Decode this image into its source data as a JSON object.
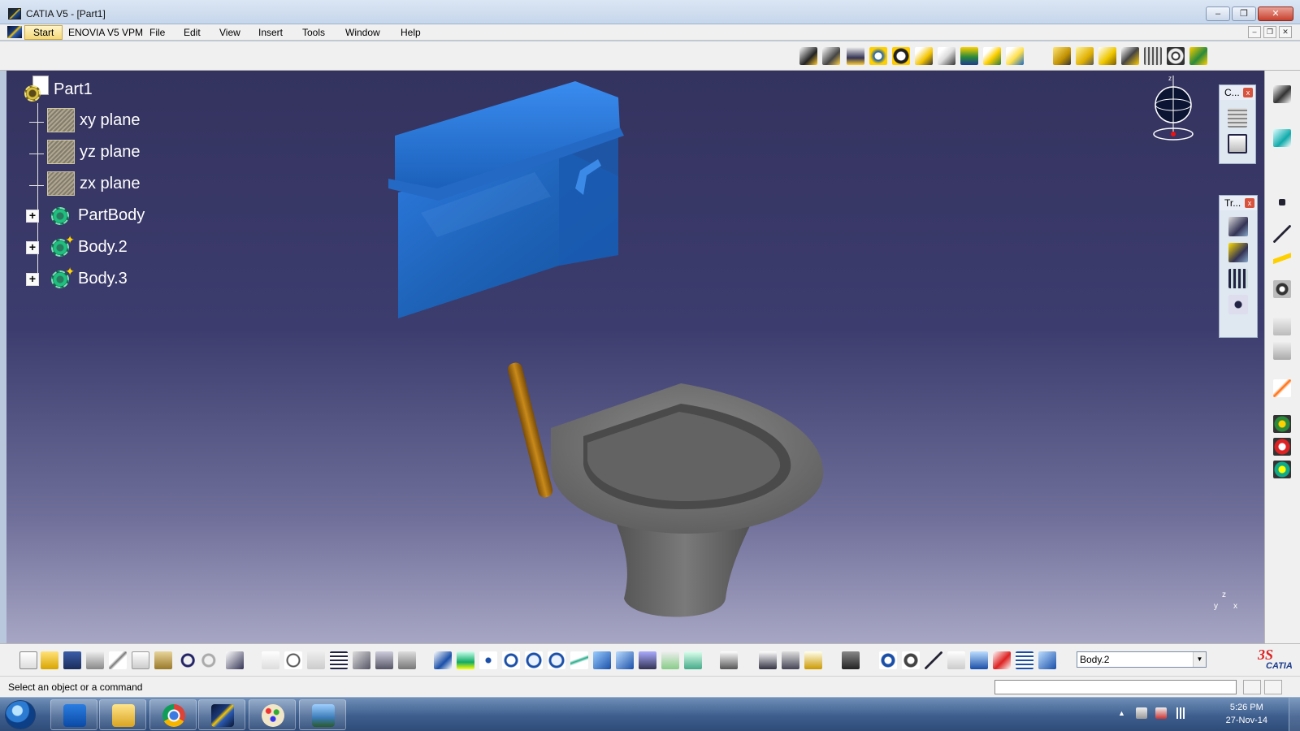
{
  "window": {
    "title": "CATIA V5 - [Part1]",
    "min_glyph": "–",
    "max_glyph": "❐",
    "close_glyph": "✕"
  },
  "menu": {
    "items": [
      "Start",
      "ENOVIA V5 VPM",
      "File",
      "Edit",
      "View",
      "Insert",
      "Tools",
      "Window",
      "Help"
    ]
  },
  "tree": {
    "root": "Part1",
    "planes": [
      "xy plane",
      "yz plane",
      "zx plane"
    ],
    "bodies": [
      "PartBody",
      "Body.2",
      "Body.3"
    ],
    "expander_glyph": "+"
  },
  "float_toolbars": {
    "compass_tb_title": "C...",
    "transform_tb_title": "Tr...",
    "close_glyph": "x"
  },
  "axis": {
    "z_label": "z",
    "x_label": "x",
    "y_label": "y"
  },
  "bottom": {
    "current_body": "Body.2",
    "combo_arrow": "▼"
  },
  "brand": {
    "ds": "3S",
    "name": "CATIA"
  },
  "status": {
    "message": "Select an object or a command"
  },
  "taskbar": {
    "time": "5:26 PM",
    "date": "27-Nov-14",
    "tray_up": "▲"
  },
  "colors": {
    "tank_blue": "#1e63b8",
    "bowl_gray": "#6a6a6a",
    "pipe_bronze": "#b87a14",
    "bg_top": "#34335f",
    "bg_bottom": "#a7a6c4",
    "tree_text": "#ffffff"
  },
  "icons": {
    "start_orb": "windows-start-icon",
    "outlook": "outlook-icon",
    "explorer": "folder-icon",
    "chrome": "chrome-icon",
    "catia": "catia-icon",
    "paint": "paint-icon",
    "photos": "photos-icon"
  }
}
